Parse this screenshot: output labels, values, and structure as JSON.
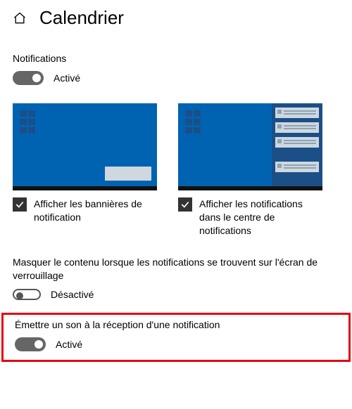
{
  "header": {
    "title": "Calendrier"
  },
  "notifications": {
    "section_label": "Notifications",
    "toggle_state": "Activé"
  },
  "banner_option": {
    "label": "Afficher les bannières de notification",
    "checked": true
  },
  "center_option": {
    "label": "Afficher les notifications dans le centre de notifications",
    "checked": true
  },
  "hide_content": {
    "description": "Masquer le contenu lorsque les notifications se trouvent sur l'écran de verrouillage",
    "toggle_state": "Désactivé"
  },
  "sound": {
    "title": "Émettre un son à la réception d'une notification",
    "toggle_state": "Activé"
  }
}
